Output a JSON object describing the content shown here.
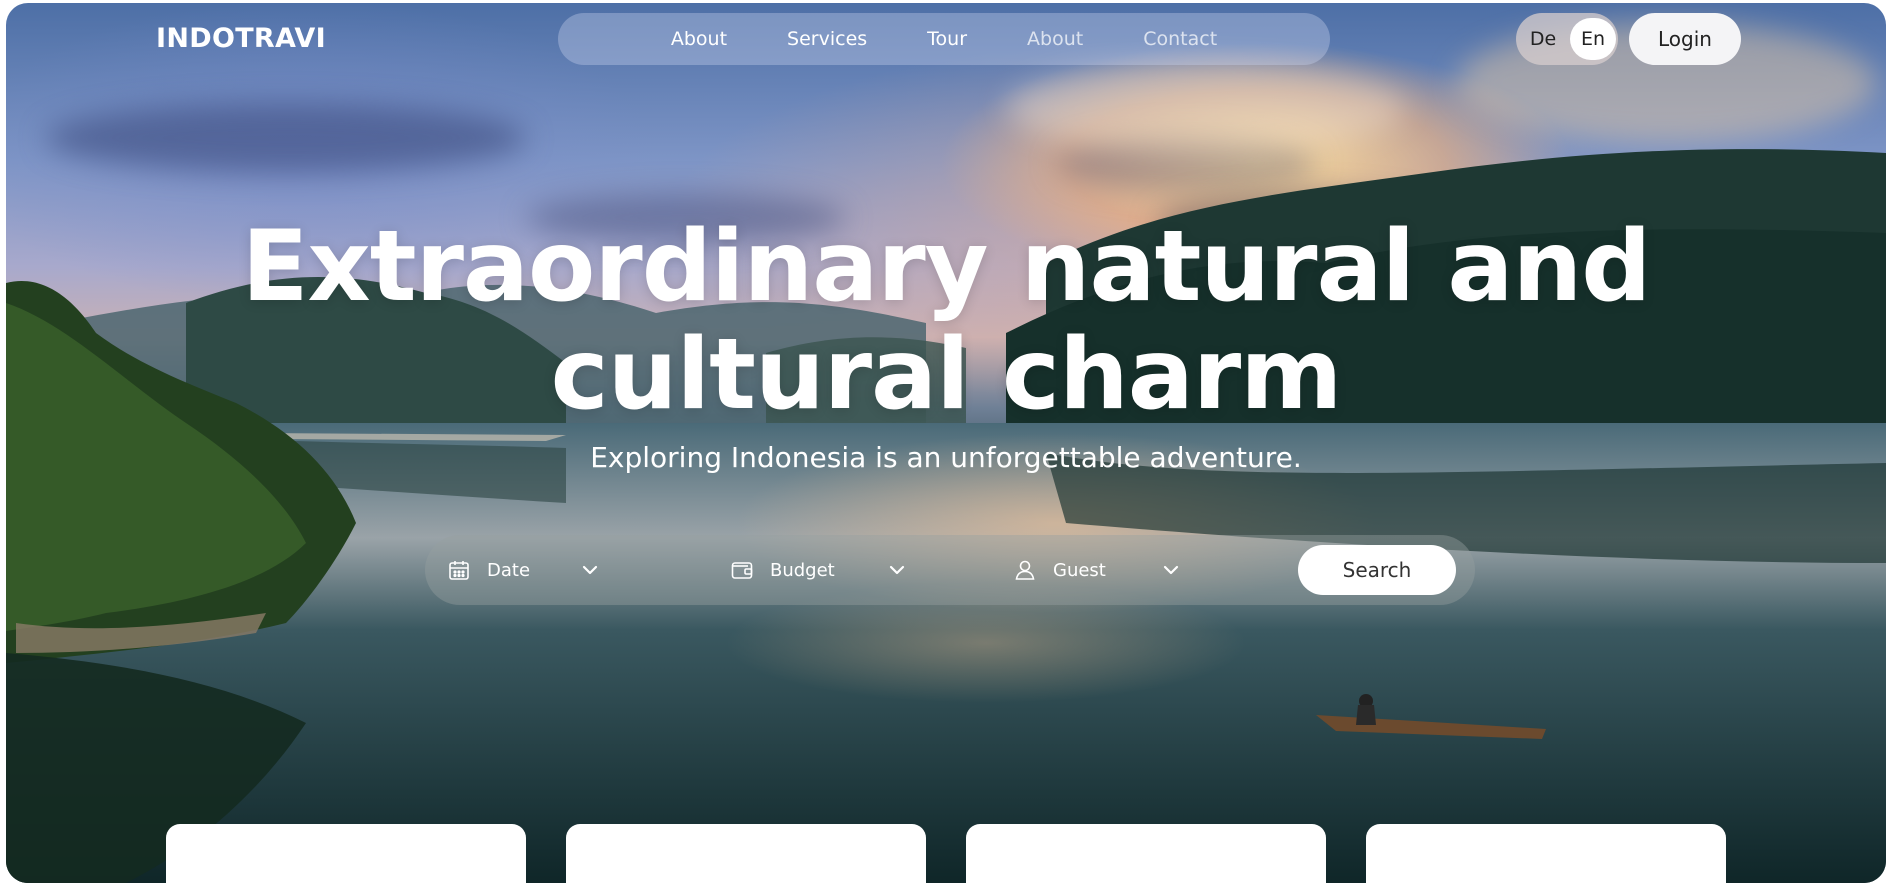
{
  "brand": {
    "logo_text": "INDOTRAVI"
  },
  "nav": {
    "links": [
      {
        "label": "About"
      },
      {
        "label": "Services"
      },
      {
        "label": "Tour"
      },
      {
        "label": "About"
      },
      {
        "label": "Contact"
      }
    ]
  },
  "language": {
    "options": [
      {
        "label": "De",
        "selected": false
      },
      {
        "label": "En",
        "selected": true
      }
    ]
  },
  "auth": {
    "login_label": "Login"
  },
  "hero": {
    "title_line1": "Extraordinary natural and",
    "title_line2": "cultural charm",
    "subtitle": "Exploring Indonesia is an unforgettable adventure."
  },
  "search": {
    "fields": [
      {
        "label": "Date",
        "icon": "calendar-icon"
      },
      {
        "label": "Budget",
        "icon": "wallet-icon"
      },
      {
        "label": "Guest",
        "icon": "user-icon"
      }
    ],
    "button_label": "Search"
  },
  "colors": {
    "accent_white": "#ffffff",
    "pill_bg": "#cdd7f0",
    "login_bg": "#f4f4f6"
  },
  "cards_count_visible": 4
}
